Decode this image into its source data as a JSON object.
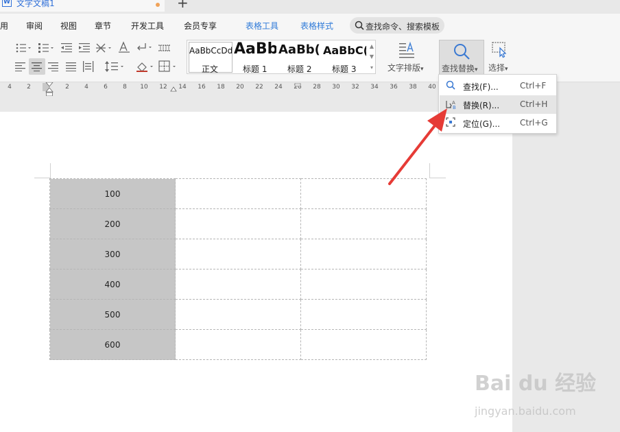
{
  "titlebar": {
    "doc_icon": "W",
    "doc_title": "文字文稿1",
    "new_tab": "+"
  },
  "menu": {
    "items": [
      "用",
      "审阅",
      "视图",
      "章节",
      "开发工具",
      "会员专享"
    ],
    "context_tabs": [
      "表格工具",
      "表格样式"
    ],
    "search_placeholder": "查找命令、搜索模板",
    "search_icon": "search-icon",
    "accent_color": "#2f7ad8"
  },
  "ribbon": {
    "styles": [
      {
        "preview": "AaBbCcDd",
        "label": "正文"
      },
      {
        "preview": "AaBb",
        "label": "标题 1"
      },
      {
        "preview": "AaBb(",
        "label": "标题 2"
      },
      {
        "preview": "AaBbC(",
        "label": "标题 3"
      }
    ],
    "text_layout_label": "文字排版",
    "find_replace_label": "查找替换",
    "select_label": "选择",
    "caret": "▾"
  },
  "ruler": {
    "ticks": [
      "4",
      "2",
      "2",
      "4",
      "6",
      "8",
      "10",
      "12",
      "14",
      "16",
      "18",
      "20",
      "22",
      "24",
      "26",
      "28",
      "30",
      "32",
      "34",
      "36",
      "38",
      "40"
    ]
  },
  "table": {
    "first_column": [
      "100",
      "200",
      "300",
      "400",
      "500",
      "600"
    ]
  },
  "dropdown": {
    "items": [
      {
        "label": "查找(F)...",
        "shortcut": "Ctrl+F",
        "icon": "search-icon"
      },
      {
        "label": "替换(R)...",
        "shortcut": "Ctrl+H",
        "icon": "replace-icon"
      },
      {
        "label": "定位(G)...",
        "shortcut": "Ctrl+G",
        "icon": "goto-icon"
      }
    ],
    "highlighted": "替换(R)..."
  },
  "annotation": {
    "arrow_color": "#e63b36"
  },
  "watermark": {
    "logo": "Bai du 经验",
    "url": "jingyan.baidu.com"
  }
}
